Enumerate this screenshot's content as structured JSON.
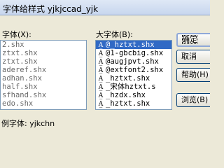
{
  "window": {
    "title": "字体给样式 yjkjccad_yjk"
  },
  "small_font": {
    "label": "字体(X):",
    "items": [
      "2.shx",
      "ztxt.shx",
      "ztxt.shx",
      "aderef.shx",
      "adhan.shx",
      "half.shx",
      "sfhand.shx",
      "edo.shx"
    ]
  },
  "big_font": {
    "label": "大字体(B):",
    "items": [
      {
        "text": "@_hztxt.shx",
        "selected": true
      },
      {
        "text": "@1-gbcbig.shx",
        "selected": false
      },
      {
        "text": "@augjpvt.shx",
        "selected": false
      },
      {
        "text": "@extfont2.shx",
        "selected": false
      },
      {
        "text": "_hztxt.shx",
        "selected": false
      },
      {
        "text": "_宋体hztxt.s",
        "selected": false
      },
      {
        "text": "_hzdx.shx",
        "selected": false
      },
      {
        "text": "_hztxt.shx",
        "selected": false
      }
    ]
  },
  "buttons": {
    "ok": "确定",
    "cancel": "取消",
    "help": "帮助(H)",
    "browse": "浏览(B)"
  },
  "sample": {
    "text": "例字体: yjkchn"
  },
  "icons": {
    "font_item": "shx-font-icon"
  }
}
